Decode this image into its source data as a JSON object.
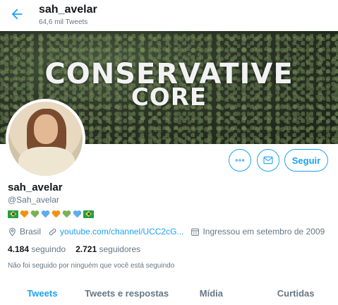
{
  "header": {
    "title": "sah_avelar",
    "tweet_count": "64,6 mil Tweets"
  },
  "banner": {
    "line1": "CONSERVATIVE",
    "line2": "CORE"
  },
  "actions": {
    "follow_label": "Seguir"
  },
  "profile": {
    "name": "sah_avelar",
    "handle": "@Sah_avelar",
    "bio_emojis": [
      "brazil-flag",
      "orange-heart",
      "green-heart",
      "blue-heart",
      "orange-heart",
      "green-heart",
      "blue-heart",
      "brazil-flag"
    ],
    "location": "Brasil",
    "website": "youtube.com/channel/UCC2cG...",
    "joined": "Ingressou em setembro de 2009"
  },
  "stats": {
    "following_count": "4.184",
    "following_label": "seguindo",
    "followers_count": "2.721",
    "followers_label": "seguidores"
  },
  "followed_by_text": "Não foi seguido por ninguém que você está seguindo",
  "tabs": [
    {
      "label": "Tweets",
      "active": true
    },
    {
      "label": "Tweets e respostas",
      "active": false
    },
    {
      "label": "Mídia",
      "active": false
    },
    {
      "label": "Curtidas",
      "active": false
    }
  ],
  "colors": {
    "accent": "#1da1f2",
    "muted": "#657786",
    "text": "#14171a"
  }
}
